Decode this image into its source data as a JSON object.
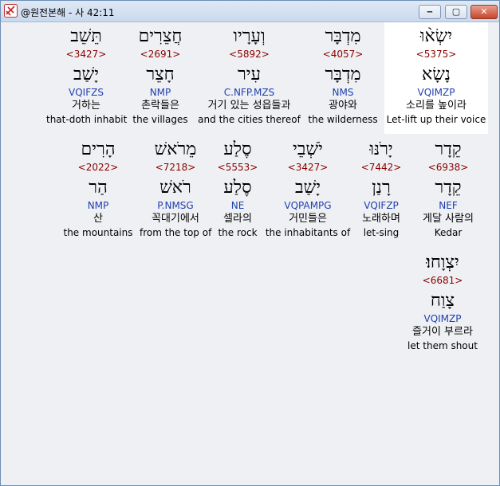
{
  "window": {
    "title": "@원전본해 - 사 42:11"
  },
  "controls": {
    "minimize_glyph": "‒",
    "maximize_glyph": "▢",
    "close_glyph": "✕"
  },
  "rows": [
    [
      {
        "inflected": "יִשְׂא֨וּ",
        "strong": "<5375>",
        "lemma": "נָשָׂא",
        "morph": "VQIMZP",
        "korean": "소리를 높이라",
        "english": "Let-lift up their voice"
      },
      {
        "inflected": "מִדְבָּר",
        "strong": "<4057>",
        "lemma": "מִדְבָּר",
        "morph": "NMS",
        "korean": "광야와",
        "english": "the wilderness"
      },
      {
        "inflected": "וְעָרָיו",
        "strong": "<5892>",
        "lemma": "עִיר",
        "morph": "C.NFP.MZS",
        "korean": "거기 있는 성읍들과",
        "english": "and the cities thereof"
      },
      {
        "inflected": "חֲצֵרִים",
        "strong": "<2691>",
        "lemma": "חָצֵר",
        "morph": "NMP",
        "korean": "촌락들은",
        "english": "the villages"
      },
      {
        "inflected": "תֵּשֵׁב",
        "strong": "<3427>",
        "lemma": "יָשַׁב",
        "morph": "VQIFZS",
        "korean": "거하는",
        "english": "that-doth inhabit"
      }
    ],
    [
      {
        "inflected": "קֵדָר",
        "strong": "<6938>",
        "lemma": "קֵדָר",
        "morph": "NEF",
        "korean": "게달 사람의",
        "english": "Kedar"
      },
      {
        "inflected": "יָרֹנּוּ",
        "strong": "<7442>",
        "lemma": "רָנַן",
        "morph": "VQIFZP",
        "korean": "노래하며",
        "english": "let-sing"
      },
      {
        "inflected": "יֹשְׁבֵי",
        "strong": "<3427>",
        "lemma": "יָשַׁב",
        "morph": "VQPAMPG",
        "korean": "거민들은",
        "english": "the inhabitants of"
      },
      {
        "inflected": "סֶלַע",
        "strong": "<5553>",
        "lemma": "סֶלַע",
        "morph": "NE",
        "korean": "셀라의",
        "english": "the rock"
      },
      {
        "inflected": "מֵרֹאשׁ",
        "strong": "<7218>",
        "lemma": "רֹאשׁ",
        "morph": "P.NMSG",
        "korean": "꼭대기에서",
        "english": "from the top of"
      },
      {
        "inflected": "הָרִים",
        "strong": "<2022>",
        "lemma": "הַר",
        "morph": "NMP",
        "korean": "산",
        "english": "the mountains"
      }
    ],
    [
      {
        "inflected": "יִצְוָחוּ׃",
        "strong": "<6681>",
        "lemma": "צָוַח",
        "morph": "VQIMZP",
        "korean": "즐거이 부르라",
        "english": "let them shout"
      }
    ]
  ]
}
